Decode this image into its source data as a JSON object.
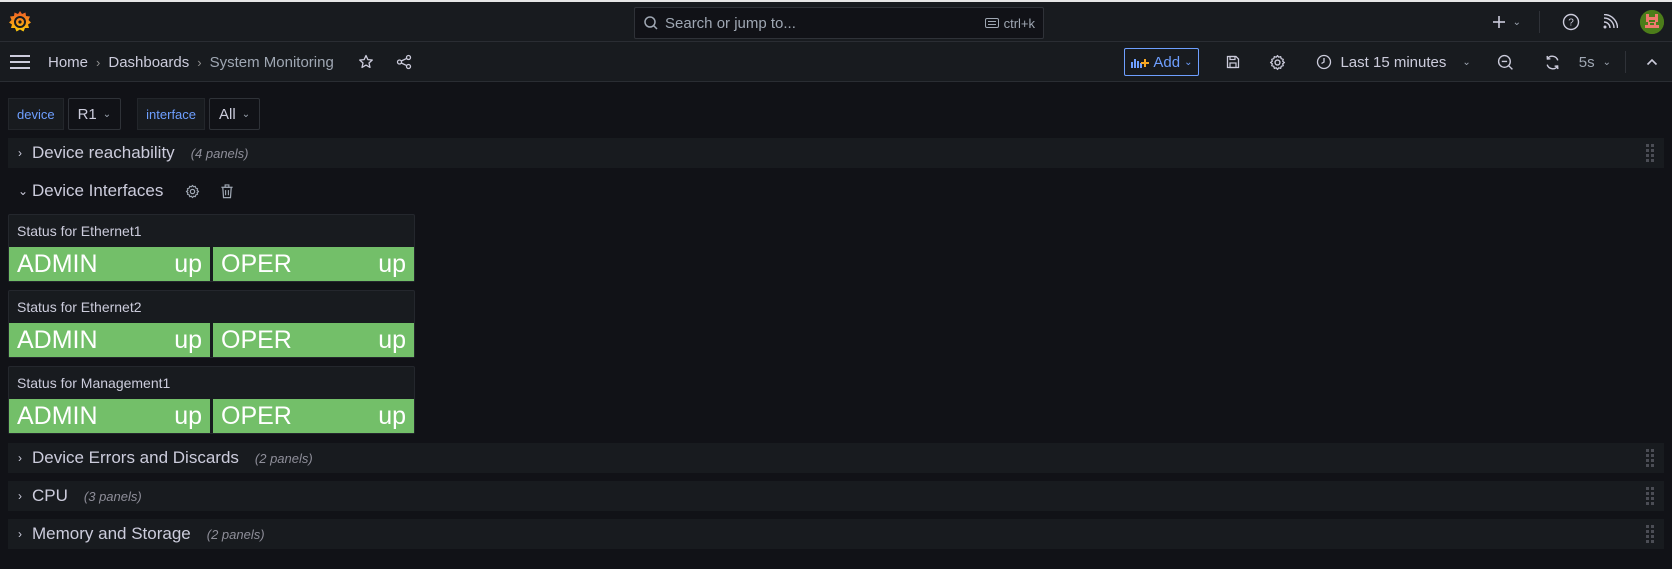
{
  "topbar": {
    "search_placeholder": "Search or jump to...",
    "search_shortcut": "ctrl+k",
    "icons": [
      "grafana-logo",
      "search-icon",
      "keyboard-icon",
      "plus-icon",
      "chevron-down-icon",
      "help-icon",
      "news-feed-icon",
      "user-avatar"
    ]
  },
  "navbar": {
    "breadcrumbs": [
      {
        "label": "Home"
      },
      {
        "label": "Dashboards"
      },
      {
        "label": "System Monitoring"
      }
    ],
    "add_label": "Add",
    "time_range": "Last 15 minutes",
    "refresh_interval": "5s"
  },
  "variables": [
    {
      "label": "device",
      "value": "R1"
    },
    {
      "label": "interface",
      "value": "All"
    }
  ],
  "rows": [
    {
      "title": "Device reachability",
      "count": "(4 panels)",
      "collapsed": true
    },
    {
      "title": "Device Interfaces",
      "count": "",
      "collapsed": false
    },
    {
      "title": "Device Errors and Discards",
      "count": "(2 panels)",
      "collapsed": true
    },
    {
      "title": "CPU",
      "count": "(3 panels)",
      "collapsed": true
    },
    {
      "title": "Memory and Storage",
      "count": "(2 panels)",
      "collapsed": true
    }
  ],
  "panels": [
    {
      "title": "Status for Ethernet1",
      "stats": [
        {
          "name": "ADMIN",
          "value": "up"
        },
        {
          "name": "OPER",
          "value": "up"
        }
      ]
    },
    {
      "title": "Status for Ethernet2",
      "stats": [
        {
          "name": "ADMIN",
          "value": "up"
        },
        {
          "name": "OPER",
          "value": "up"
        }
      ]
    },
    {
      "title": "Status for Management1",
      "stats": [
        {
          "name": "ADMIN",
          "value": "up"
        },
        {
          "name": "OPER",
          "value": "up"
        }
      ]
    }
  ],
  "colors": {
    "status_up": "#73bf69",
    "accent": "#6e9fff",
    "background": "#111217",
    "panel": "#181b1f"
  }
}
